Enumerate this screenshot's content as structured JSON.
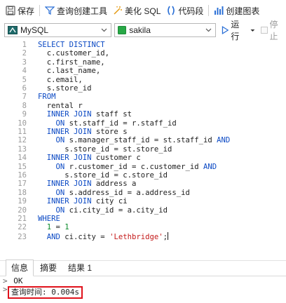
{
  "toolbar": {
    "save": "保存",
    "query_builder": "查询创建工具",
    "beautify": "美化 SQL",
    "code_snippet": "代码段",
    "create_chart": "创建图表"
  },
  "selectors": {
    "connection": "MySQL",
    "database": "sakila",
    "run": "运行",
    "stop": "停止"
  },
  "editor": {
    "lines": [
      {
        "n": "1",
        "indent": "",
        "tokens": [
          {
            "t": "SELECT DISTINCT",
            "c": "kw"
          }
        ]
      },
      {
        "n": "2",
        "indent": "  ",
        "tokens": [
          {
            "t": "c.customer_id,",
            "c": "plain"
          }
        ]
      },
      {
        "n": "3",
        "indent": "  ",
        "tokens": [
          {
            "t": "c.first_name,",
            "c": "plain"
          }
        ]
      },
      {
        "n": "4",
        "indent": "  ",
        "tokens": [
          {
            "t": "c.last_name,",
            "c": "plain"
          }
        ]
      },
      {
        "n": "5",
        "indent": "  ",
        "tokens": [
          {
            "t": "c.email,",
            "c": "plain"
          }
        ]
      },
      {
        "n": "6",
        "indent": "  ",
        "tokens": [
          {
            "t": "s.store_id",
            "c": "plain"
          }
        ]
      },
      {
        "n": "7",
        "indent": "",
        "tokens": [
          {
            "t": "FROM",
            "c": "kw"
          }
        ]
      },
      {
        "n": "8",
        "indent": "  ",
        "tokens": [
          {
            "t": "rental r",
            "c": "plain"
          }
        ]
      },
      {
        "n": "9",
        "indent": "  ",
        "tokens": [
          {
            "t": "INNER JOIN",
            "c": "kw"
          },
          {
            "t": " staff st",
            "c": "plain"
          }
        ]
      },
      {
        "n": "10",
        "indent": "    ",
        "tokens": [
          {
            "t": "ON",
            "c": "kw"
          },
          {
            "t": " st.staff_id = r.staff_id",
            "c": "plain"
          }
        ]
      },
      {
        "n": "11",
        "indent": "  ",
        "tokens": [
          {
            "t": "INNER JOIN",
            "c": "kw"
          },
          {
            "t": " store s",
            "c": "plain"
          }
        ]
      },
      {
        "n": "12",
        "indent": "    ",
        "tokens": [
          {
            "t": "ON",
            "c": "kw"
          },
          {
            "t": " s.manager_staff_id = st.staff_id ",
            "c": "plain"
          },
          {
            "t": "AND",
            "c": "kw"
          }
        ]
      },
      {
        "n": "13",
        "indent": "      ",
        "tokens": [
          {
            "t": "s.store_id = st.store_id",
            "c": "plain"
          }
        ]
      },
      {
        "n": "14",
        "indent": "  ",
        "tokens": [
          {
            "t": "INNER JOIN",
            "c": "kw"
          },
          {
            "t": " customer c",
            "c": "plain"
          }
        ]
      },
      {
        "n": "15",
        "indent": "    ",
        "tokens": [
          {
            "t": "ON",
            "c": "kw"
          },
          {
            "t": " r.customer_id = c.customer_id ",
            "c": "plain"
          },
          {
            "t": "AND",
            "c": "kw"
          }
        ]
      },
      {
        "n": "16",
        "indent": "      ",
        "tokens": [
          {
            "t": "s.store_id = c.store_id",
            "c": "plain"
          }
        ]
      },
      {
        "n": "17",
        "indent": "  ",
        "tokens": [
          {
            "t": "INNER JOIN",
            "c": "kw"
          },
          {
            "t": " address a",
            "c": "plain"
          }
        ]
      },
      {
        "n": "18",
        "indent": "    ",
        "tokens": [
          {
            "t": "ON",
            "c": "kw"
          },
          {
            "t": " s.address_id = a.address_id",
            "c": "plain"
          }
        ]
      },
      {
        "n": "19",
        "indent": "  ",
        "tokens": [
          {
            "t": "INNER JOIN",
            "c": "kw"
          },
          {
            "t": " city ci",
            "c": "plain"
          }
        ]
      },
      {
        "n": "20",
        "indent": "    ",
        "tokens": [
          {
            "t": "ON",
            "c": "kw"
          },
          {
            "t": " ci.city_id = a.city_id",
            "c": "plain"
          }
        ]
      },
      {
        "n": "21",
        "indent": "",
        "tokens": [
          {
            "t": "WHERE",
            "c": "kw"
          }
        ]
      },
      {
        "n": "22",
        "indent": "  ",
        "tokens": [
          {
            "t": "1",
            "c": "num"
          },
          {
            "t": " = ",
            "c": "plain"
          },
          {
            "t": "1",
            "c": "num"
          }
        ]
      },
      {
        "n": "23",
        "indent": "  ",
        "tokens": [
          {
            "t": "AND",
            "c": "kw"
          },
          {
            "t": " ci.city = ",
            "c": "plain"
          },
          {
            "t": "'Lethbridge'",
            "c": "str"
          },
          {
            "t": ";",
            "c": "plain"
          }
        ]
      }
    ]
  },
  "result_tabs": [
    "信息",
    "摘要",
    "结果 1"
  ],
  "output": {
    "status": "OK",
    "query_time": "查询时间: 0.004s"
  },
  "colors": {
    "keyword": "#0b49c4",
    "string": "#c41a1a",
    "number": "#0a8a2a",
    "highlight_border": "#e0121c"
  }
}
